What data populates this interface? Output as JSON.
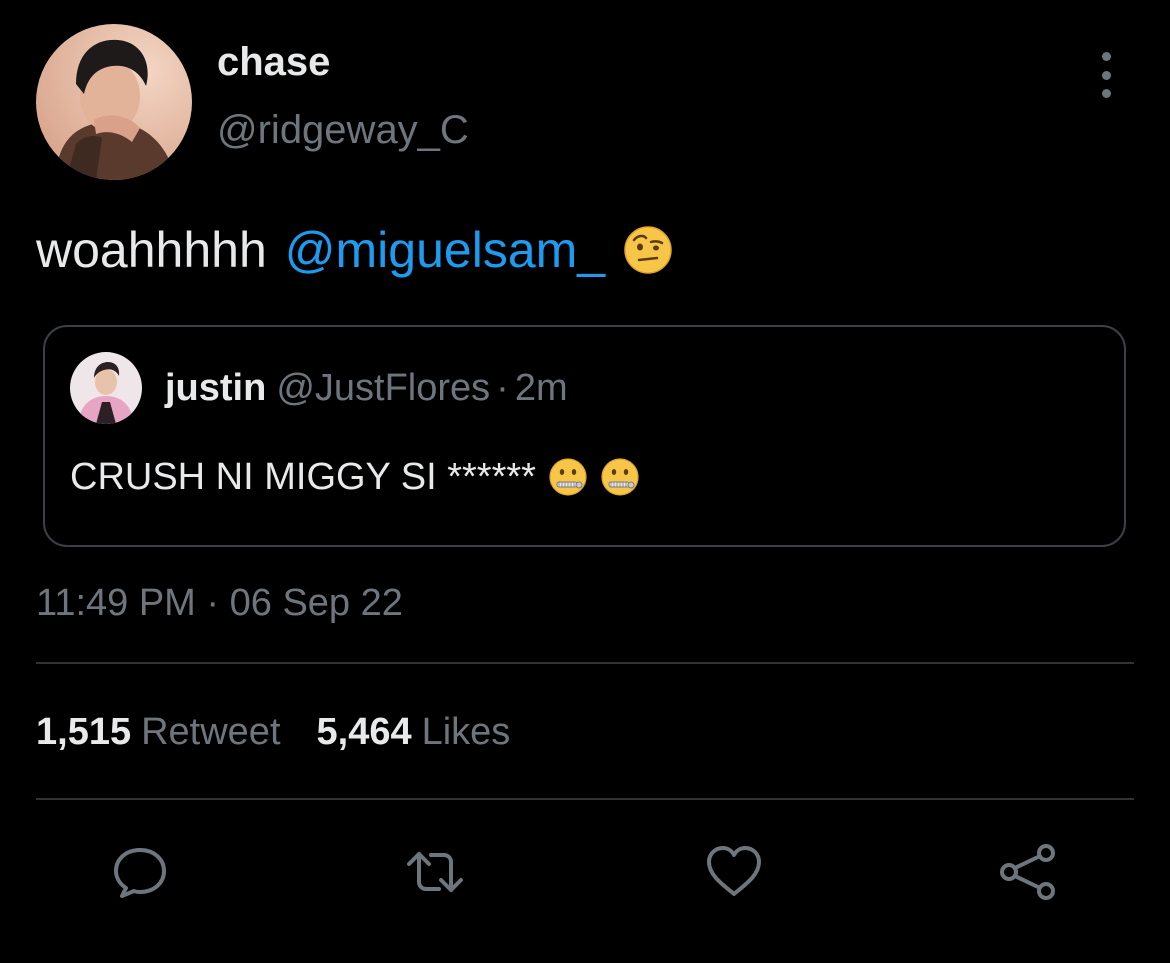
{
  "author": {
    "display_name": "chase",
    "handle": "@ridgeway_C",
    "avatar": "profile-photo"
  },
  "tweet": {
    "text": "woahhhhh",
    "mention": "@miguelsam_",
    "emoji": "face-with-raised-eyebrow"
  },
  "quoted_tweet": {
    "name": "justin",
    "handle": "@JustFlores",
    "separator": "·",
    "time": "2m",
    "text": "CRUSH NI MIGGY SI ******",
    "emojis": [
      "zipper-mouth-face",
      "zipper-mouth-face"
    ]
  },
  "meta": {
    "time": "11:49 PM",
    "separator": "·",
    "date": "06 Sep 22"
  },
  "stats": {
    "retweets_count": "1,515",
    "retweets_label": "Retweet",
    "likes_count": "5,464",
    "likes_label": "Likes"
  },
  "actions": [
    "reply-icon",
    "retweet-icon",
    "like-icon",
    "share-icon"
  ],
  "colors": {
    "background": "#000000",
    "text": "#e7e9ea",
    "secondary": "#6e767d",
    "link": "#1d9bf0",
    "border": "#2f3336"
  }
}
